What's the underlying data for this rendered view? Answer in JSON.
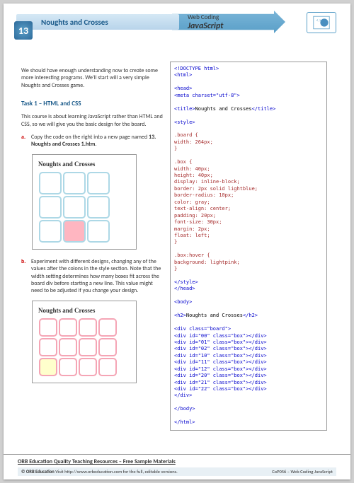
{
  "header": {
    "num": "13",
    "title": "Noughts and Crosses",
    "arrow1": "Web Coding",
    "arrow2": "JavaScript"
  },
  "intro": "We should have enough understanding now to create some more interesting programs. We'll start will a very simple Noughts and Crosses game.",
  "task": {
    "heading": "Task 1 – HTML and CSS",
    "intro": "This course is about learning JavaScript rather than HTML and CSS, so we will give you the basic design for the board."
  },
  "stepA": {
    "letter": "a.",
    "text": "Copy the code on the right into a new page named",
    "file": "13. Noughts and Crosses 1.htm"
  },
  "stepB": {
    "letter": "b.",
    "text": "Experiment with different designs, changing any of the values after the colons in the style section. Note that the width setting determines how many boxes fit across the board div before starting a new line. This value might need to be adjusted if you change your design."
  },
  "gridTitle": "Noughts and Crosses",
  "code": {
    "l1": "<!DOCTYPE html>",
    "l2": "<html>",
    "l3": "<head>",
    "l4": "<meta charset=\"utf-8\">",
    "l5a": "<title>",
    "l5b": "Noughts and Crosses",
    "l5c": "</title>",
    "l6": "<style>",
    "l7": ".board {",
    "l8": "    width: 264px;",
    "l9": "}",
    "l10": ".box {",
    "l11": "    width: 40px;",
    "l12": "    height: 40px;",
    "l13": "    display: inline-block;",
    "l14": "    border: 2px solid lightblue;",
    "l15": "    border-radius: 10px;",
    "l16": "    color: gray;",
    "l17": "    text-align: center;",
    "l18": "    padding: 20px;",
    "l19": "    font-size: 30px;",
    "l20": "    margin: 2px;",
    "l21": "    float: left;",
    "l22": "}",
    "l23": ".box:hover {",
    "l24": "    background: lightpink;",
    "l25": "}",
    "l26": "</style>",
    "l27": "</head>",
    "l28": "<body>",
    "l29a": "<h2>",
    "l29b": "Noughts and Crosses",
    "l29c": "</h2>",
    "l30": "<div class=\"board\">",
    "l31": "  <div id=\"00\" class=\"box\"></div>",
    "l32": "  <div id=\"01\" class=\"box\"></div>",
    "l33": "  <div id=\"02\" class=\"box\"></div>",
    "l34": "  <div id=\"10\" class=\"box\"></div>",
    "l35": "  <div id=\"11\" class=\"box\"></div>",
    "l36": "  <div id=\"12\" class=\"box\"></div>",
    "l37": "  <div id=\"20\" class=\"box\"></div>",
    "l38": "  <div id=\"21\" class=\"box\"></div>",
    "l39": "  <div id=\"22\" class=\"box\"></div>",
    "l40": "</div>",
    "l41": "</body>",
    "l42": "</html>"
  },
  "footer": {
    "title": "ORB Education Quality Teaching Resources – Free Sample Materials",
    "left": "© ORB Education",
    "mid": "Visit http://www.orbeducation.com for the full, editable versions.",
    "right": "CoP056 – Web Coding JavaScript"
  }
}
